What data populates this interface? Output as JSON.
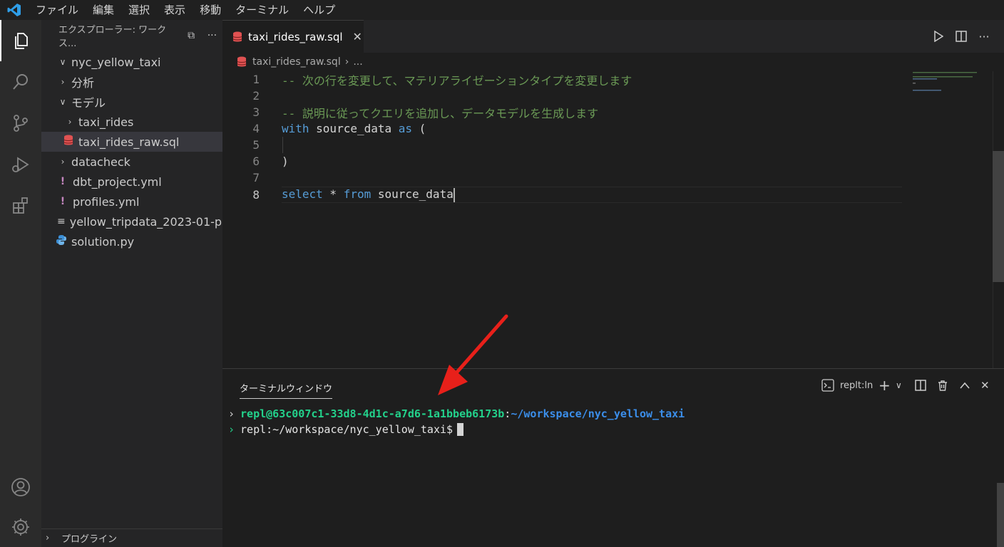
{
  "menu": {
    "items": [
      "ファイル",
      "編集",
      "選択",
      "表示",
      "移動",
      "ターミナル",
      "ヘルプ"
    ]
  },
  "activity_bar": {
    "icons": [
      "explorer-icon",
      "search-icon",
      "source-control-icon",
      "run-debug-icon",
      "extensions-icon",
      "account-icon",
      "settings-gear-icon"
    ]
  },
  "sidebar": {
    "title": "エクスプローラー: ワークス...",
    "tree": [
      {
        "label": "nyc_yellow_taxi",
        "kind": "folder-open"
      },
      {
        "label": "分析",
        "kind": "folder"
      },
      {
        "label": "モデル",
        "kind": "folder-open"
      },
      {
        "label": "taxi_rides",
        "kind": "folder"
      },
      {
        "label": "taxi_rides_raw.sql",
        "kind": "sql-file"
      },
      {
        "label": "datacheck",
        "kind": "folder"
      },
      {
        "label": "dbt_project.yml",
        "kind": "yaml-file"
      },
      {
        "label": "profiles.yml",
        "kind": "yaml-file"
      },
      {
        "label": "yellow_tripdata_2023-01-p...",
        "kind": "text-file"
      },
      {
        "label": "solution.py",
        "kind": "python-file"
      }
    ],
    "outline_label": "プログライン"
  },
  "editor": {
    "tab_label": "taxi_rides_raw.sql",
    "breadcrumb_file": "taxi_rides_raw.sql",
    "breadcrumb_rest": "...",
    "line_numbers": [
      "1",
      "2",
      "3",
      "4",
      "5",
      "6",
      "7",
      "8"
    ],
    "lines": {
      "l1": "-- 次の行を変更して、マテリアライゼーションタイプを変更します",
      "l3": "-- 説明に従ってクエリを追加し、データモデルを生成します",
      "l4_kw1": "with",
      "l4_id": " source_data ",
      "l4_kw2": "as",
      "l4_paren": " (",
      "l6": ")",
      "l8_kw1": "select",
      "l8_mid": " * ",
      "l8_kw2": "from",
      "l8_id": " source_data"
    }
  },
  "panel": {
    "tab_label": "ターミナルウィンドウ",
    "shell_label": "replt:ln",
    "terminal": {
      "line1_user": "repl@63c007c1-33d8-4d1c-a7d6-1a1bbeb6173b",
      "line1_sep": ":",
      "line1_path": "~/workspace/nyc_yellow_taxi",
      "line2": "repl:~/workspace/nyc_yellow_taxi$"
    }
  },
  "colors": {
    "accent": "#007acc",
    "annotation_arrow": "#e8201a",
    "comment": "#6a9955",
    "keyword": "#569cd6"
  }
}
